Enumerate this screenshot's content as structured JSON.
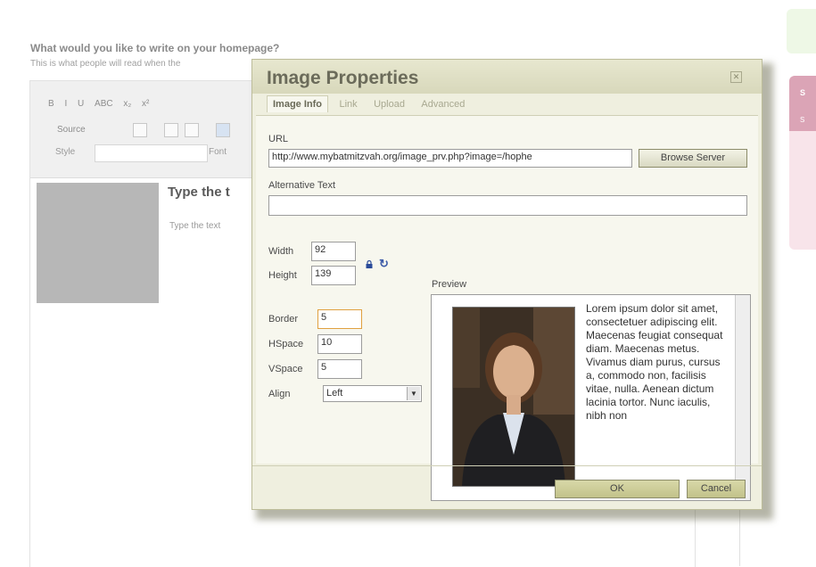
{
  "page": {
    "question": "What would you like to write on your homepage?",
    "subtext": "This is what people will read when the",
    "toolbar_row1": [
      "B",
      "I",
      "U",
      "ABC",
      "x₂",
      "x²"
    ],
    "toolbar_source": "Source",
    "toolbar_style": "Style",
    "toolbar_font": "Font",
    "content_heading": "Type the t",
    "content_text": "Type the text",
    "pink_head": "S",
    "pink_sub": "S"
  },
  "dialog": {
    "title": "Image Properties",
    "close_icon": "close-icon",
    "tabs": [
      {
        "label": "Image Info",
        "active": true
      },
      {
        "label": "Link",
        "active": false
      },
      {
        "label": "Upload",
        "active": false
      },
      {
        "label": "Advanced",
        "active": false
      }
    ],
    "url_label": "URL",
    "url_value": "http://www.mybatmitzvah.org/image_prv.php?image=/hophe",
    "browse_button": "Browse Server",
    "alt_label": "Alternative Text",
    "alt_value": "",
    "width_label": "Width",
    "width_value": "92",
    "height_label": "Height",
    "height_value": "139",
    "border_label": "Border",
    "border_value": "5",
    "hspace_label": "HSpace",
    "hspace_value": "10",
    "vspace_label": "VSpace",
    "vspace_value": "5",
    "align_label": "Align",
    "align_value": "Left",
    "preview_label": "Preview",
    "preview_text": "Lorem ipsum dolor sit amet, consectetuer adipiscing elit. Maecenas feugiat consequat diam. Maecenas metus. Vivamus diam purus, cursus a, commodo non, facilisis vitae, nulla. Aenean dictum lacinia tortor. Nunc iaculis, nibh non",
    "ok_button": "OK",
    "cancel_button": "Cancel"
  }
}
